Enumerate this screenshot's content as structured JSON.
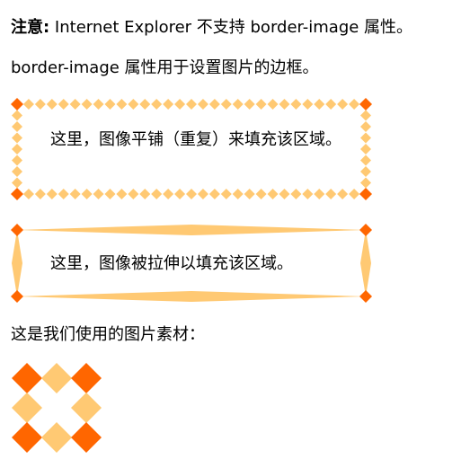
{
  "note": {
    "label": "注意:",
    "text": " Internet Explorer 不支持 border-image 属性。"
  },
  "intro": "border-image 属性用于设置图片的边框。",
  "round_box": {
    "text": "这里，图像平铺（重复）来填充该区域。"
  },
  "stretch_box": {
    "text": "这里，图像被拉伸以填充该区域。"
  },
  "materials_caption": "这是我们使用的图片素材：",
  "colors": {
    "corner": "#ff6600",
    "edge": "#ffc973",
    "text": "#000000",
    "background": "#ffffff"
  }
}
